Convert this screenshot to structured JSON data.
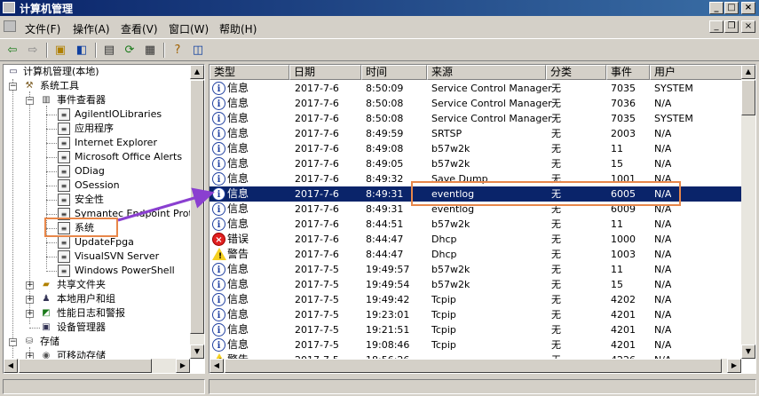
{
  "window": {
    "title": "计算机管理"
  },
  "menu": [
    "文件(F)",
    "操作(A)",
    "查看(V)",
    "窗口(W)",
    "帮助(H)"
  ],
  "tree": {
    "items": [
      {
        "label": "计算机管理(本地)",
        "icon": "computer-icon"
      },
      {
        "label": "系统工具",
        "icon": "tools-icon"
      },
      {
        "label": "事件查看器",
        "icon": "event-viewer-icon"
      },
      {
        "label": "AgilentIOLibraries",
        "icon": "log-icon"
      },
      {
        "label": "应用程序",
        "icon": "log-icon"
      },
      {
        "label": "Internet Explorer",
        "icon": "log-icon"
      },
      {
        "label": "Microsoft Office Alerts",
        "icon": "log-icon"
      },
      {
        "label": "ODiag",
        "icon": "log-icon"
      },
      {
        "label": "OSession",
        "icon": "log-icon"
      },
      {
        "label": "安全性",
        "icon": "log-icon"
      },
      {
        "label": "Symantec Endpoint Protect",
        "icon": "log-icon"
      },
      {
        "label": "系统",
        "icon": "log-icon"
      },
      {
        "label": "UpdateFpga",
        "icon": "log-icon"
      },
      {
        "label": "VisualSVN Server",
        "icon": "log-icon"
      },
      {
        "label": "Windows PowerShell",
        "icon": "log-icon"
      },
      {
        "label": "共享文件夹",
        "icon": "shared-folder-icon"
      },
      {
        "label": "本地用户和组",
        "icon": "users-icon"
      },
      {
        "label": "性能日志和警报",
        "icon": "performance-icon"
      },
      {
        "label": "设备管理器",
        "icon": "device-manager-icon"
      },
      {
        "label": "存储",
        "icon": "storage-icon"
      },
      {
        "label": "可移动存储",
        "icon": "removable-storage-icon"
      }
    ]
  },
  "list": {
    "columns": [
      "类型",
      "日期",
      "时间",
      "来源",
      "分类",
      "事件",
      "用户"
    ],
    "rows": [
      {
        "type": "信息",
        "kind": "info",
        "date": "2017-7-6",
        "time": "8:50:09",
        "source": "Service Control Manager",
        "category": "无",
        "event": "7035",
        "user": "SYSTEM"
      },
      {
        "type": "信息",
        "kind": "info",
        "date": "2017-7-6",
        "time": "8:50:08",
        "source": "Service Control Manager",
        "category": "无",
        "event": "7036",
        "user": "N/A"
      },
      {
        "type": "信息",
        "kind": "info",
        "date": "2017-7-6",
        "time": "8:50:08",
        "source": "Service Control Manager",
        "category": "无",
        "event": "7035",
        "user": "SYSTEM"
      },
      {
        "type": "信息",
        "kind": "info",
        "date": "2017-7-6",
        "time": "8:49:59",
        "source": "SRTSP",
        "category": "无",
        "event": "2003",
        "user": "N/A"
      },
      {
        "type": "信息",
        "kind": "info",
        "date": "2017-7-6",
        "time": "8:49:08",
        "source": "b57w2k",
        "category": "无",
        "event": "11",
        "user": "N/A"
      },
      {
        "type": "信息",
        "kind": "info",
        "date": "2017-7-6",
        "time": "8:49:05",
        "source": "b57w2k",
        "category": "无",
        "event": "15",
        "user": "N/A"
      },
      {
        "type": "信息",
        "kind": "info",
        "date": "2017-7-6",
        "time": "8:49:32",
        "source": "Save Dump",
        "category": "无",
        "event": "1001",
        "user": "N/A"
      },
      {
        "type": "信息",
        "kind": "info",
        "date": "2017-7-6",
        "time": "8:49:31",
        "source": "eventlog",
        "category": "无",
        "event": "6005",
        "user": "N/A",
        "selected": true
      },
      {
        "type": "信息",
        "kind": "info",
        "date": "2017-7-6",
        "time": "8:49:31",
        "source": "eventlog",
        "category": "无",
        "event": "6009",
        "user": "N/A"
      },
      {
        "type": "信息",
        "kind": "info",
        "date": "2017-7-6",
        "time": "8:44:51",
        "source": "b57w2k",
        "category": "无",
        "event": "11",
        "user": "N/A"
      },
      {
        "type": "错误",
        "kind": "error",
        "date": "2017-7-6",
        "time": "8:44:47",
        "source": "Dhcp",
        "category": "无",
        "event": "1000",
        "user": "N/A"
      },
      {
        "type": "警告",
        "kind": "warning",
        "date": "2017-7-6",
        "time": "8:44:47",
        "source": "Dhcp",
        "category": "无",
        "event": "1003",
        "user": "N/A"
      },
      {
        "type": "信息",
        "kind": "info",
        "date": "2017-7-5",
        "time": "19:49:57",
        "source": "b57w2k",
        "category": "无",
        "event": "11",
        "user": "N/A"
      },
      {
        "type": "信息",
        "kind": "info",
        "date": "2017-7-5",
        "time": "19:49:54",
        "source": "b57w2k",
        "category": "无",
        "event": "15",
        "user": "N/A"
      },
      {
        "type": "信息",
        "kind": "info",
        "date": "2017-7-5",
        "time": "19:49:42",
        "source": "Tcpip",
        "category": "无",
        "event": "4202",
        "user": "N/A"
      },
      {
        "type": "信息",
        "kind": "info",
        "date": "2017-7-5",
        "time": "19:23:01",
        "source": "Tcpip",
        "category": "无",
        "event": "4201",
        "user": "N/A"
      },
      {
        "type": "信息",
        "kind": "info",
        "date": "2017-7-5",
        "time": "19:21:51",
        "source": "Tcpip",
        "category": "无",
        "event": "4201",
        "user": "N/A"
      },
      {
        "type": "信息",
        "kind": "info",
        "date": "2017-7-5",
        "time": "19:08:46",
        "source": "Tcpip",
        "category": "无",
        "event": "4201",
        "user": "N/A"
      },
      {
        "type": "警告",
        "kind": "warning",
        "date": "2017-7-5",
        "time": "18:56:26",
        "source": "",
        "category": "无",
        "event": "4226",
        "user": "N/A"
      }
    ]
  },
  "colors": {
    "selection": "#0a246a",
    "highlight": "#e8874a",
    "arrow": "#8a3fd0"
  }
}
